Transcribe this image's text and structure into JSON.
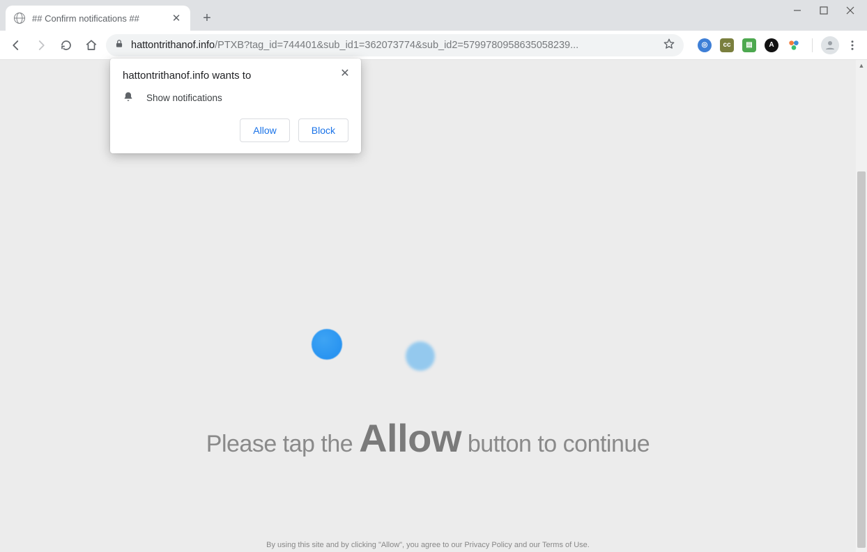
{
  "window": {
    "min_label": "minimize",
    "max_label": "maximize",
    "close_label": "close"
  },
  "tab": {
    "title": "## Confirm notifications ##"
  },
  "toolbar": {
    "url_domain": "hattontrithanof.info",
    "url_path": "/PTXB?tag_id=744401&sub_id1=362073774&sub_id2=5799780958635058239..."
  },
  "extensions": [
    {
      "name": "ext-spiral",
      "bg": "#3e7fd6",
      "label": "◎"
    },
    {
      "name": "ext-cc",
      "bg": "#7a7f3e",
      "label": "cc"
    },
    {
      "name": "ext-doc",
      "bg": "#4da84f",
      "label": "▤"
    },
    {
      "name": "ext-a",
      "bg": "#111",
      "label": "A"
    }
  ],
  "popup": {
    "title": "hattontrithanof.info wants to",
    "item": "Show notifications",
    "allow": "Allow",
    "block": "Block"
  },
  "page": {
    "headline_pre": "Please tap the ",
    "headline_big": "Allow",
    "headline_post": " button to continue",
    "footer": "By using this site and by clicking \"Allow\", you agree to our Privacy Policy and our Terms of Use."
  }
}
